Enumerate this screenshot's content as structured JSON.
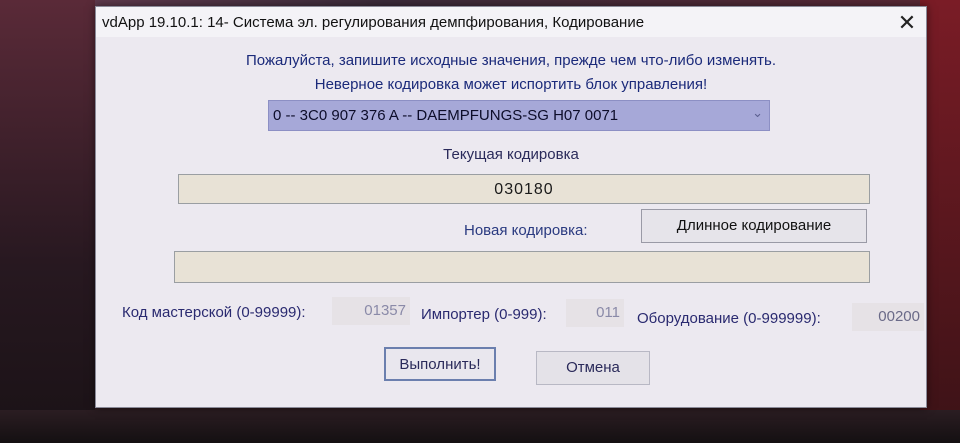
{
  "window": {
    "title": "vdApp 19.10.1: 14- Система эл. регулирования демпфирования,  Кодирование",
    "close_glyph": "✕"
  },
  "warnings": {
    "line1": "Пожалуйста, запишите исходные значения, прежде чем что-либо изменять.",
    "line2": "Неверное кодировка может испортить блок управления!"
  },
  "ecu_select": {
    "selected": "0 -- 3C0 907 376 A -- DAEMPFUNGS-SG H07 0071",
    "arrow": "⌄"
  },
  "current_coding": {
    "label": "Текущая кодировка",
    "value": "030180"
  },
  "new_coding": {
    "label": "Новая кодировка:",
    "long_button": "Длинное кодирование",
    "value": ""
  },
  "fields": {
    "workshop": {
      "label": "Код мастерской (0-99999):",
      "value": "01357"
    },
    "importer": {
      "label": "Импортер (0-999):",
      "value": "011"
    },
    "equipment": {
      "label": "Оборудование (0-999999):",
      "value": "00200"
    }
  },
  "buttons": {
    "run": "Выполнить!",
    "cancel": "Отмена"
  }
}
